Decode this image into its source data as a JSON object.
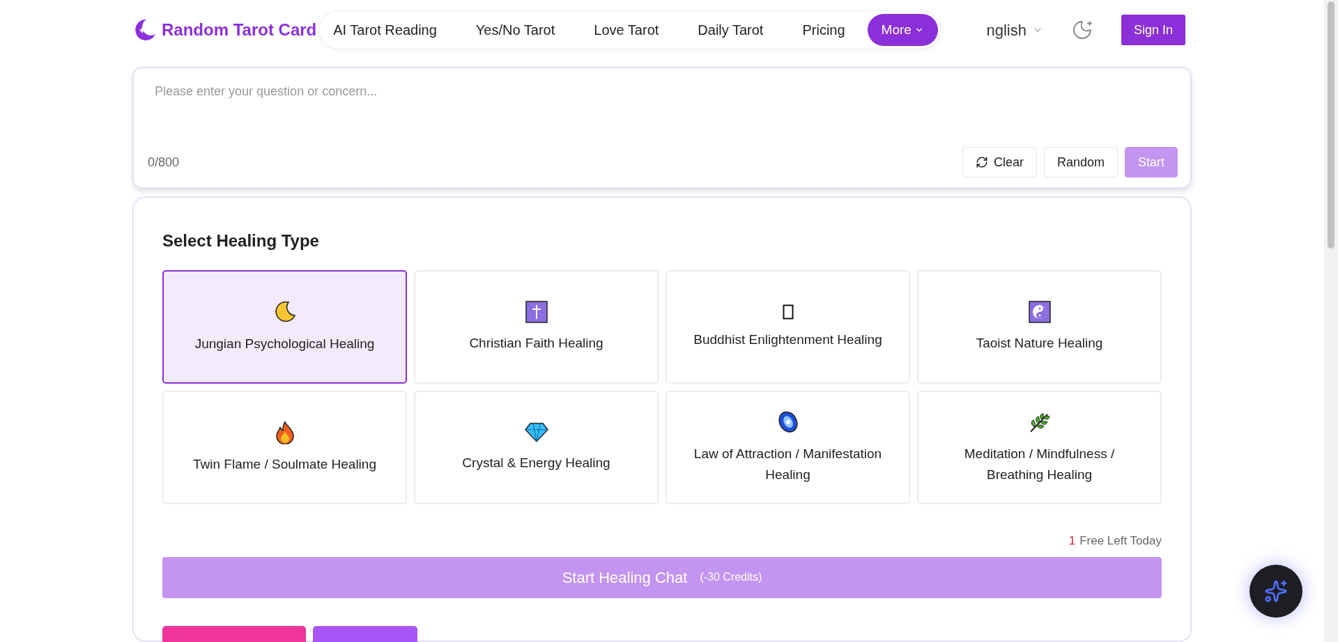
{
  "header": {
    "logo_text": "Random Tarot Card",
    "nav": [
      {
        "label": "AI Tarot Reading",
        "selected": false
      },
      {
        "label": "Yes/No Tarot",
        "selected": false
      },
      {
        "label": "Love Tarot",
        "selected": false
      },
      {
        "label": "Daily Tarot",
        "selected": false
      },
      {
        "label": "Pricing",
        "selected": false
      }
    ],
    "more": "More",
    "language": "nglish",
    "sign_in": "Sign In"
  },
  "question": {
    "placeholder": "Please enter your question or concern...",
    "count": "0/800",
    "buttons": [
      {
        "label": "Clear",
        "kind": "clear"
      },
      {
        "label": "Random",
        "kind": "plain"
      },
      {
        "label": "Start",
        "kind": "primary",
        "disabled": true
      }
    ]
  },
  "healing": {
    "title": "Select Healing Type",
    "types": [
      {
        "label": "Jungian Psychological Healing",
        "selected": true
      },
      {
        "label": "Christian Faith Healing",
        "selected": false
      },
      {
        "label": "Buddhist Enlightenment Healing",
        "selected": false
      },
      {
        "label": "Taoist Nature Healing",
        "selected": false
      },
      {
        "label": "Twin Flame / Soulmate Healing",
        "selected": false
      },
      {
        "label": "Crystal & Energy Healing",
        "selected": false
      },
      {
        "label": "Law of Attraction / Manifestation Healing",
        "selected": false
      },
      {
        "label": "Meditation / Mindfulness / Breathing Healing",
        "selected": false
      }
    ],
    "free_count": "1",
    "free_text": "Free Left Today",
    "start": {
      "label": "Start Healing Chat",
      "cost": "(-30 Credits)",
      "disabled": true
    }
  }
}
